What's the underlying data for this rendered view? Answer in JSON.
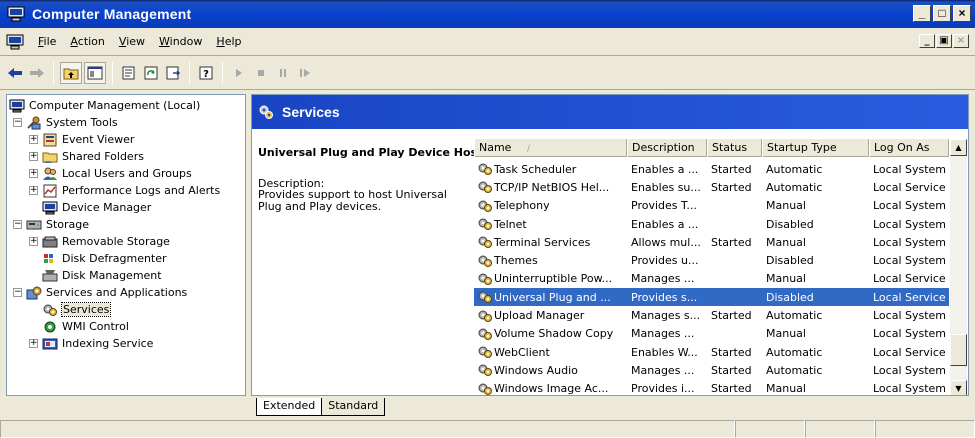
{
  "window": {
    "title": "Computer Management",
    "minimize": "_",
    "maximize": "□",
    "close": "×"
  },
  "menu": {
    "items": [
      "File",
      "Action",
      "View",
      "Window",
      "Help"
    ],
    "mdi_minimize": "_",
    "mdi_restore": "▣",
    "mdi_close": "×"
  },
  "tree": {
    "items": [
      {
        "label": "Computer Management (Local)",
        "icon": "computer-icon"
      },
      {
        "label": "System Tools",
        "icon": "tools-icon"
      },
      {
        "label": "Event Viewer",
        "icon": "event-viewer-icon"
      },
      {
        "label": "Shared Folders",
        "icon": "shared-folders-icon"
      },
      {
        "label": "Local Users and Groups",
        "icon": "users-icon"
      },
      {
        "label": "Performance Logs and Alerts",
        "icon": "performance-icon"
      },
      {
        "label": "Device Manager",
        "icon": "device-manager-icon"
      },
      {
        "label": "Storage",
        "icon": "storage-icon"
      },
      {
        "label": "Removable Storage",
        "icon": "removable-storage-icon"
      },
      {
        "label": "Disk Defragmenter",
        "icon": "defrag-icon"
      },
      {
        "label": "Disk Management",
        "icon": "disk-management-icon"
      },
      {
        "label": "Services and Applications",
        "icon": "services-apps-icon"
      },
      {
        "label": "Services",
        "icon": "gear-icon"
      },
      {
        "label": "WMI Control",
        "icon": "wmi-icon"
      },
      {
        "label": "Indexing Service",
        "icon": "indexing-icon"
      }
    ]
  },
  "services": {
    "header": "Services",
    "selected_title": "Universal Plug and Play Device Host",
    "description_label": "Description:",
    "description_text": "Provides support to host Universal Plug and Play devices.",
    "columns": [
      "Name",
      "Description",
      "Status",
      "Startup Type",
      "Log On As"
    ],
    "rows": [
      [
        "Task Scheduler",
        "Enables a ...",
        "Started",
        "Automatic",
        "Local System"
      ],
      [
        "TCP/IP NetBIOS Hel...",
        "Enables su...",
        "Started",
        "Automatic",
        "Local Service"
      ],
      [
        "Telephony",
        "Provides T...",
        "",
        "Manual",
        "Local System"
      ],
      [
        "Telnet",
        "Enables a ...",
        "",
        "Disabled",
        "Local System"
      ],
      [
        "Terminal Services",
        "Allows mul...",
        "Started",
        "Manual",
        "Local System"
      ],
      [
        "Themes",
        "Provides u...",
        "",
        "Disabled",
        "Local System"
      ],
      [
        "Uninterruptible Pow...",
        "Manages ...",
        "",
        "Manual",
        "Local Service"
      ],
      [
        "Universal Plug and ...",
        "Provides s...",
        "",
        "Disabled",
        "Local Service"
      ],
      [
        "Upload Manager",
        "Manages s...",
        "Started",
        "Automatic",
        "Local System"
      ],
      [
        "Volume Shadow Copy",
        "Manages ...",
        "",
        "Manual",
        "Local System"
      ],
      [
        "WebClient",
        "Enables W...",
        "Started",
        "Automatic",
        "Local Service"
      ],
      [
        "Windows Audio",
        "Manages ...",
        "Started",
        "Automatic",
        "Local System"
      ],
      [
        "Windows Image Ac...",
        "Provides i...",
        "Started",
        "Manual",
        "Local System"
      ]
    ],
    "selected_row": 7
  },
  "tabs": [
    "Extended",
    "Standard"
  ],
  "colors": {
    "title_bar": "#0841CF",
    "header_blue": "#1E4CD0",
    "selection": "#316AC5",
    "chrome": "#ECE9D8"
  }
}
